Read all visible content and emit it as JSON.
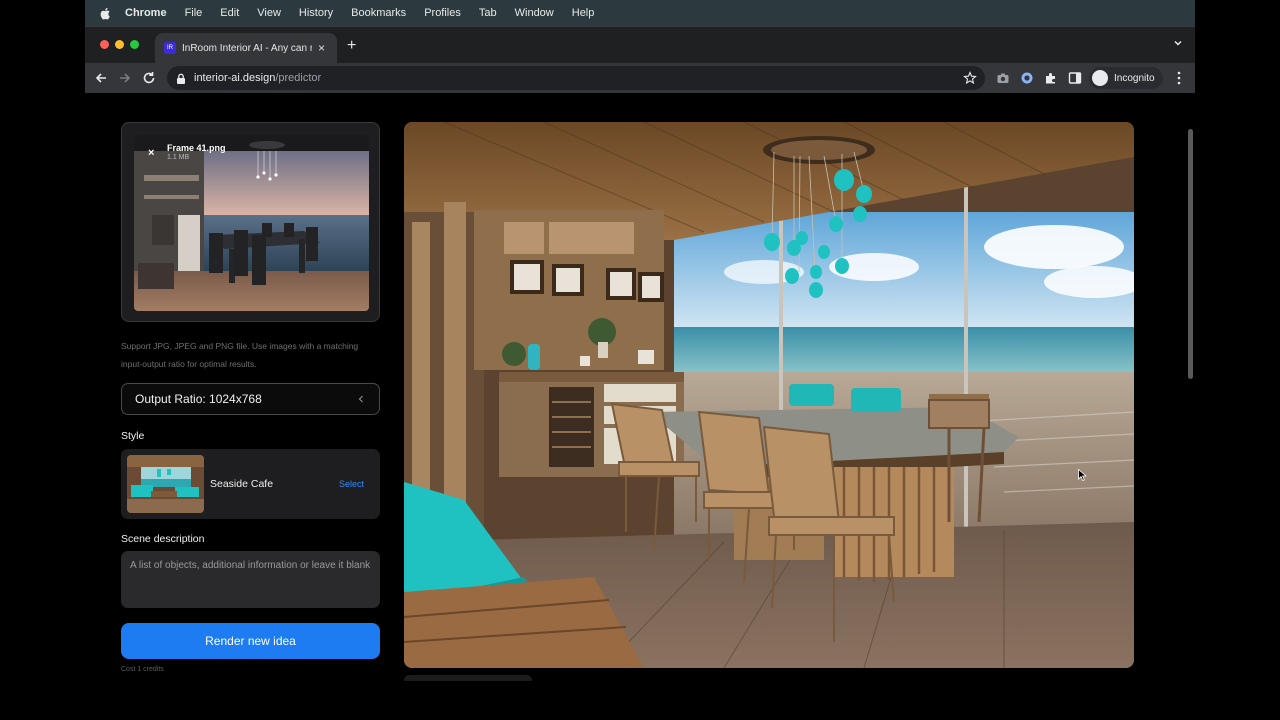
{
  "menubar": {
    "app": "Chrome",
    "items": [
      "File",
      "Edit",
      "View",
      "History",
      "Bookmarks",
      "Profiles",
      "Tab",
      "Window",
      "Help"
    ]
  },
  "browser": {
    "tab_title": "InRoom Interior AI - Any can re",
    "favicon_text": "IR",
    "url_host": "interior-ai.design",
    "url_path": "/predictor",
    "profile_label": "Incognito"
  },
  "upload": {
    "file_name": "Frame 41.png",
    "file_size": "1.1 MB",
    "support_text": "Support JPG, JPEG and PNG file. Use images with a matching input-output ratio for optimal results."
  },
  "ratio": {
    "label": "Output Ratio: 1024x768"
  },
  "style": {
    "section_label": "Style",
    "name": "Seaside Cafe",
    "select_label": "Select"
  },
  "scene": {
    "section_label": "Scene description",
    "placeholder": "A list of objects, additional information or leave it blank"
  },
  "render": {
    "button_label": "Render new idea",
    "cost_text": "Cost 1 credits"
  },
  "colors": {
    "accent": "#1d7cf2",
    "select_link": "#2e8cff",
    "turquoise": "#1fc2c0"
  }
}
